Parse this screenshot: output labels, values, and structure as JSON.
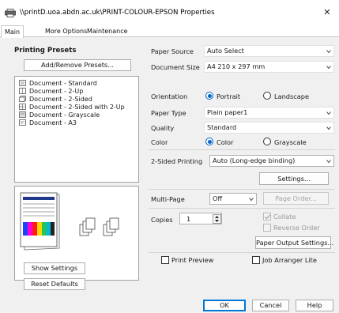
{
  "window": {
    "title": "\\\\printD.uoa.abdn.ac.uk\\PRINT-COLOUR-EPSON Properties",
    "icon": "printer-icon",
    "close_glyph": "✕"
  },
  "tabs": [
    {
      "label": "Main",
      "active": true
    },
    {
      "label": "More Options",
      "active": false
    },
    {
      "label": "Maintenance",
      "active": false
    }
  ],
  "presets": {
    "title": "Printing Presets",
    "add_remove_label": "Add/Remove Presets...",
    "items": [
      "Document - Standard",
      "Document - 2-Up",
      "Document - 2-Sided",
      "Document - 2-Sided with 2-Up",
      "Document - Grayscale",
      "Document - A3"
    ]
  },
  "left_buttons": {
    "show_settings": "Show Settings",
    "reset_defaults": "Reset Defaults"
  },
  "paper": {
    "source_label": "Paper Source",
    "source_value": "Auto Select",
    "size_label": "Document Size",
    "size_value": "A4 210 x 297 mm"
  },
  "orientation": {
    "label": "Orientation",
    "portrait": "Portrait",
    "landscape": "Landscape",
    "selected": "Portrait"
  },
  "paper_type": {
    "label": "Paper Type",
    "value": "Plain paper1"
  },
  "quality": {
    "label": "Quality",
    "value": "Standard"
  },
  "color": {
    "label": "Color",
    "color_option": "Color",
    "grayscale_option": "Grayscale",
    "selected": "Color"
  },
  "two_sided": {
    "label": "2-Sided Printing",
    "value": "Auto (Long-edge binding)",
    "settings_button": "Settings..."
  },
  "multi_page": {
    "label": "Multi-Page",
    "value": "Off",
    "page_order_button": "Page Order..."
  },
  "copies": {
    "label": "Copies",
    "value": "1",
    "collate": "Collate",
    "collate_checked": true,
    "reverse_order": "Reverse Order",
    "reverse_checked": false,
    "output_settings_button": "Paper Output Settings..."
  },
  "print_preview": {
    "label": "Print Preview",
    "checked": false
  },
  "job_arranger": {
    "label": "Job Arranger Lite",
    "checked": false
  },
  "footer": {
    "ok": "OK",
    "cancel": "Cancel",
    "help": "Help"
  },
  "colors": {
    "accent": "#0066cc",
    "dialog_bg": "#f0f0f0",
    "border": "#adadad"
  }
}
